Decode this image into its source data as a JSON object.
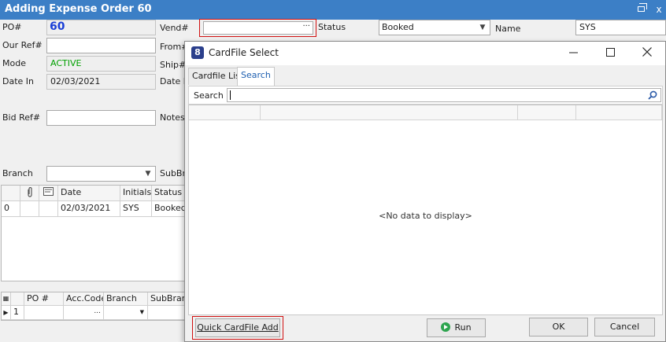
{
  "window": {
    "title": "Adding Expense Order 60",
    "restore_icon": "restore-icon",
    "close_glyph": "x"
  },
  "form": {
    "po_label": "PO#",
    "po_value": "60",
    "ourref_label": "Our Ref#",
    "ourref_value": "",
    "mode_label": "Mode",
    "mode_value": "ACTIVE",
    "datein_label": "Date In",
    "datein_value": "02/03/2021",
    "bidref_label": "Bid Ref#",
    "bidref_value": "",
    "branch_label": "Branch",
    "branch_value": "",
    "vend_label": "Vend#",
    "vend_value": "",
    "from_label": "From#",
    "ship_label": "Ship#",
    "dated_label": "Date D",
    "notes_label": "Notes",
    "subbranch_label": "SubBra",
    "status_label": "Status",
    "status_value": "Booked",
    "name_label": "Name",
    "name_value": "SYS",
    "ellipsis": "···"
  },
  "history_grid": {
    "headers": [
      "",
      "",
      "",
      "Date",
      "Initials",
      "Status"
    ],
    "rows": [
      [
        "0",
        "",
        "",
        "02/03/2021",
        "SYS",
        "Booked"
      ]
    ]
  },
  "lines_grid": {
    "headers": [
      "",
      "PO #",
      "Acc.Code",
      "Branch",
      "SubBranc"
    ],
    "rows": [
      [
        "1",
        "",
        "...",
        "",
        ""
      ]
    ]
  },
  "dialog": {
    "title": "CardFile Select",
    "app_icon_letter": "8",
    "tabs": [
      "Cardfile List",
      "Search"
    ],
    "active_tab": "Search",
    "search_label": "Search",
    "search_value": "",
    "no_data": "<No data to display>",
    "buttons": {
      "quick_add": "Quick CardFile Add",
      "run": "Run",
      "ok": "OK",
      "cancel": "Cancel"
    }
  },
  "colors": {
    "titlebar": "#3c7fc6",
    "highlight": "#d01010",
    "po_number": "#1a3fd6",
    "active_mode": "#00a000",
    "run_icon": "#2da44e"
  }
}
